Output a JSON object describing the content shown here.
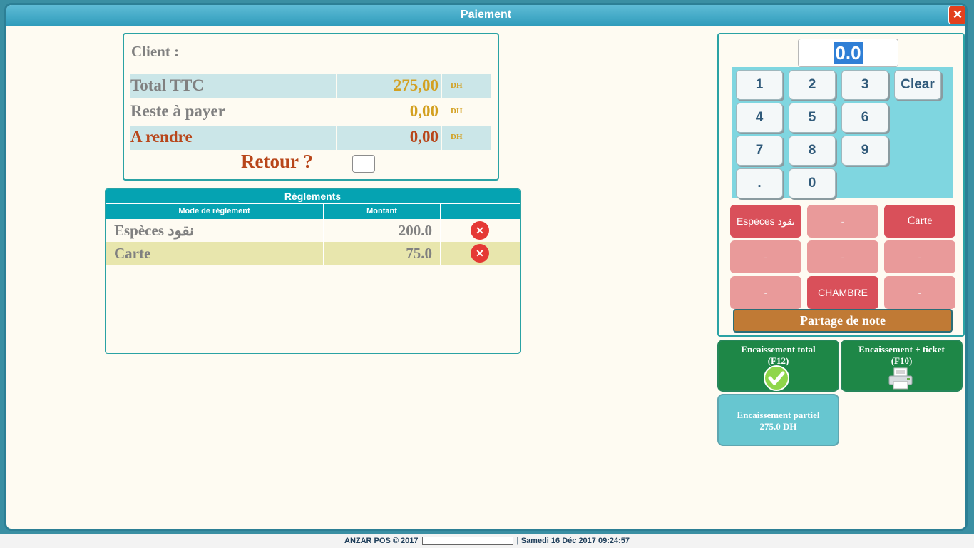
{
  "window": {
    "title": "Paiement",
    "close_glyph": "✕"
  },
  "summary": {
    "client_label": "Client :",
    "rows": [
      {
        "label": "Total TTC",
        "value": "275,00",
        "currency": "DH"
      },
      {
        "label": "Reste à payer",
        "value": "0,00",
        "currency": "DH"
      },
      {
        "label": "A rendre",
        "value": "0,00",
        "currency": "DH"
      }
    ],
    "retour_label": "Retour ?"
  },
  "reglements": {
    "title": "Réglements",
    "columns": [
      "Mode de réglement",
      "Montant"
    ],
    "rows": [
      {
        "mode": "Espèces نقود",
        "montant": "200.0"
      },
      {
        "mode": "Carte",
        "montant": "75.0"
      }
    ],
    "delete_glyph": "✕"
  },
  "keypad": {
    "display_value": "0.0",
    "keys": [
      "1",
      "2",
      "3",
      "Clear",
      "4",
      "5",
      "6",
      "7",
      "8",
      "9",
      ".",
      "0"
    ]
  },
  "payment_modes": [
    {
      "label": "Espèces نقود",
      "active": true
    },
    {
      "label": "-",
      "active": false
    },
    {
      "label": "Carte",
      "active": true
    },
    {
      "label": "-",
      "active": false
    },
    {
      "label": "-",
      "active": false
    },
    {
      "label": "-",
      "active": false
    },
    {
      "label": "-",
      "active": false
    },
    {
      "label": "CHAMBRE",
      "active": true
    },
    {
      "label": "-",
      "active": false
    }
  ],
  "partage_label": "Partage de note",
  "actions": {
    "total_line1": "Encaissement total",
    "total_line2": "(F12)",
    "ticket_line1": "Encaissement + ticket",
    "ticket_line2": "(F10)",
    "partiel_line1": "Encaissement partiel",
    "partiel_line2": "275.0 DH"
  },
  "colors": {
    "accent": "#05a3b2",
    "green": "#1e8747",
    "pay_active": "#d9505a",
    "pay_empty": "#e99a9a",
    "orange": "#c07a35"
  },
  "status": {
    "left": "ANZAR POS © 2017",
    "right": "| Samedi 16 Déc 2017 09:24:57"
  }
}
